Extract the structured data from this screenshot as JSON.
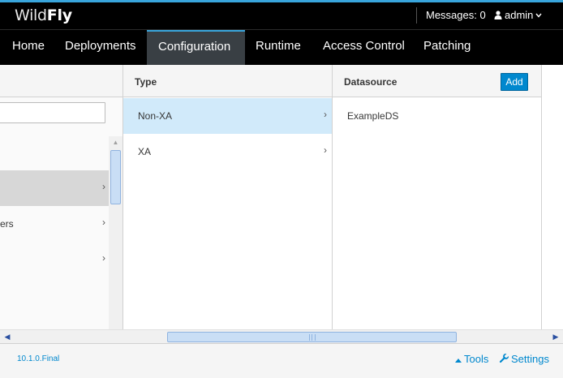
{
  "header": {
    "logo_light": "Wild",
    "logo_bold": "Fly",
    "messages": "Messages: 0",
    "user": "admin",
    "accent_color": "#39a5dc"
  },
  "nav": {
    "items": [
      {
        "label": "Home"
      },
      {
        "label": "Deployments"
      },
      {
        "label": "Configuration"
      },
      {
        "label": "Runtime"
      },
      {
        "label": "Access Control"
      },
      {
        "label": "Patching"
      }
    ],
    "active": "Configuration"
  },
  "column1": {
    "rows": [
      {
        "label": ""
      },
      {
        "label": "ers"
      },
      {
        "label": ""
      }
    ]
  },
  "column2": {
    "title": "Type",
    "rows": [
      {
        "label": "Non-XA"
      },
      {
        "label": "XA"
      }
    ],
    "selected": "Non-XA"
  },
  "column3": {
    "title": "Datasource",
    "add_label": "Add",
    "rows": [
      {
        "label": "ExampleDS"
      }
    ]
  },
  "footer": {
    "version": "10.1.0.Final",
    "tools": "Tools",
    "settings": "Settings",
    "link_color": "#0088ce"
  },
  "icons": [
    "user-icon",
    "chevron-down-icon",
    "chevron-right-icon",
    "caret-up-icon",
    "wrench-icon"
  ]
}
